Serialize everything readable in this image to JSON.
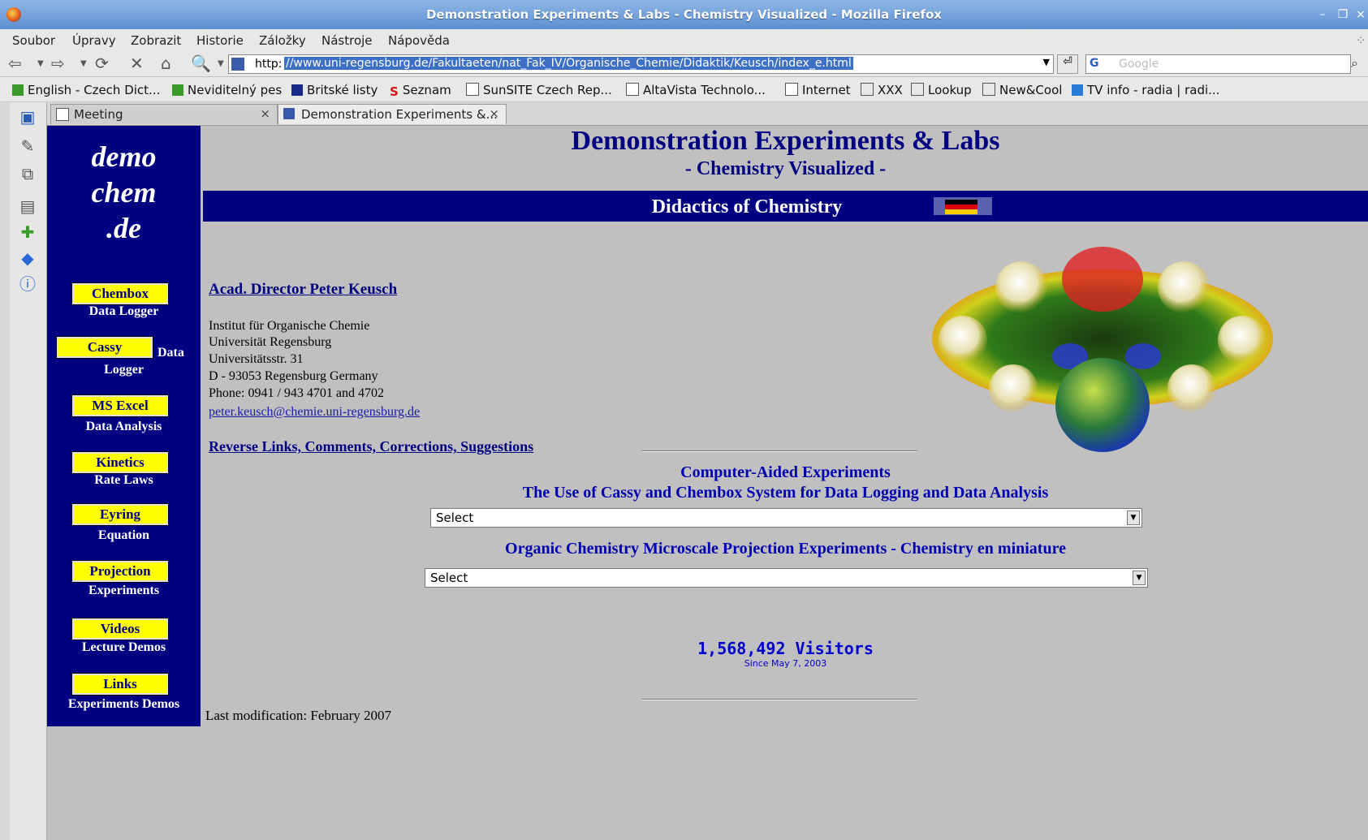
{
  "window": {
    "title": "Demonstration Experiments & Labs - Chemistry Visualized - Mozilla Firefox"
  },
  "menu": [
    "Soubor",
    "Úpravy",
    "Zobrazit",
    "Historie",
    "Záložky",
    "Nástroje",
    "Nápověda"
  ],
  "nav": {
    "url_scheme": "http:",
    "url_rest": "//www.uni-regensburg.de/Fakultaeten/nat_Fak_IV/Organische_Chemie/Didaktik/Keusch/index_e.html",
    "search_placeholder": "Google",
    "search_engine_glyph": "G"
  },
  "bookmarks": [
    "English - Czech Dict...",
    "Neviditelný pes",
    "Britské listy",
    "Seznam",
    "SunSITE Czech Rep...",
    "AltaVista Technolo...",
    "Internet",
    "XXX",
    "Lookup",
    "New&Cool",
    "TV info - radia | radi..."
  ],
  "tabs": [
    {
      "label": "Meeting"
    },
    {
      "label": "Demonstration Experiments &..."
    }
  ],
  "page": {
    "logo": [
      "demo",
      "chem",
      ".de"
    ],
    "leftnav": [
      {
        "label": "Chembox",
        "sub": "Data Logger"
      },
      {
        "label": "Cassy",
        "side": "Data",
        "sub": "Logger"
      },
      {
        "label": "MS Excel",
        "sub": "Data Analysis"
      },
      {
        "label": "Kinetics",
        "sub": "Rate Laws"
      },
      {
        "label": "Eyring",
        "sub": "Equation"
      },
      {
        "label": "Projection",
        "sub": "Experiments"
      },
      {
        "label": "Videos",
        "sub": "Lecture Demos"
      },
      {
        "label": "Links",
        "sub": "Experiments Demos"
      }
    ],
    "h1": "Demonstration Experiments & Labs",
    "h2": "- Chemistry Visualized -",
    "banner": "Didactics of Chemistry",
    "director_link": "Acad. Director Peter Keusch ",
    "address": [
      "Institut für Organische Chemie",
      "Universität Regensburg",
      "Universitätsstr. 31",
      "D - 93053 Regensburg Germany",
      "Phone: 0941 / 943 4701 and 4702"
    ],
    "email": "peter.keusch@chemie.uni-regensburg.de ",
    "reverse_link": "Reverse Links, Comments, Corrections, Suggestions ",
    "section1_title1": "Computer-Aided Experiments",
    "section1_title2": "The Use of Cassy and Chembox System for Data Logging and Data Analysis",
    "select1": "Select",
    "section2_title": "Organic Chemistry Microscale Projection Experiments - Chemistry en miniature",
    "select2": "Select",
    "visitors": "1,568,492 Visitors",
    "since": "Since May 7, 2003",
    "lastmod": "Last modification: February 2007"
  }
}
